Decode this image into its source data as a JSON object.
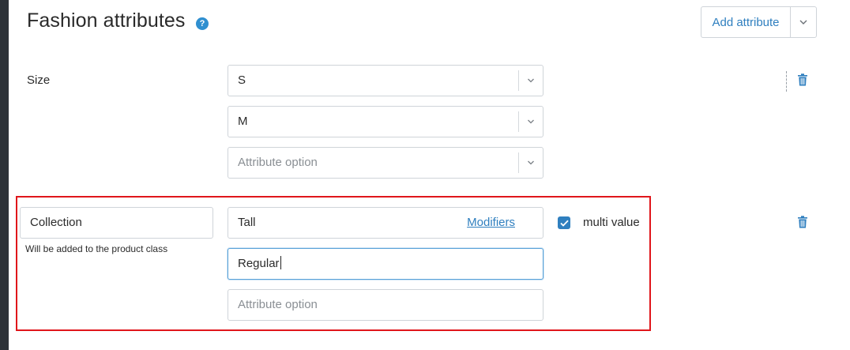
{
  "header": {
    "title": "Fashion attributes",
    "help_icon": "question-circle-icon",
    "add_button_label": "Add attribute"
  },
  "size_row": {
    "label": "Size",
    "options": [
      {
        "value": "S",
        "is_placeholder": false
      },
      {
        "value": "M",
        "is_placeholder": false
      },
      {
        "value": "Attribute option",
        "is_placeholder": true
      }
    ]
  },
  "collection_row": {
    "name_value": "Collection",
    "note": "Will be added to the product class",
    "first_value": "Tall",
    "modifiers_link": "Modifiers",
    "second_value": "Regular",
    "placeholder": "Attribute option",
    "multi_value_label": "multi value",
    "multi_value_checked": true
  },
  "colors": {
    "accent": "#2f7fbf",
    "highlight_border": "#e0161b",
    "placeholder_text": "#8a8f94",
    "border": "#cfd4d9"
  }
}
